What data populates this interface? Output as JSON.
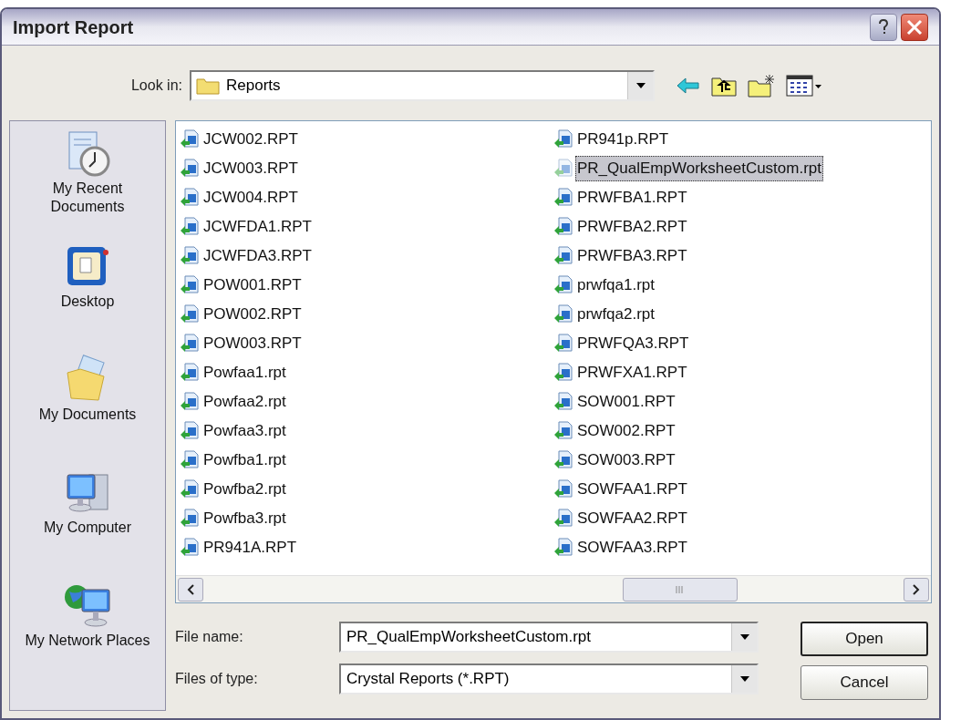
{
  "window": {
    "title": "Import Report"
  },
  "look_in": {
    "label": "Look in:",
    "value": "Reports"
  },
  "places": [
    {
      "kind": "recent",
      "label": "My Recent Documents"
    },
    {
      "kind": "desktop",
      "label": "Desktop"
    },
    {
      "kind": "documents",
      "label": "My Documents"
    },
    {
      "kind": "computer",
      "label": "My Computer"
    },
    {
      "kind": "network",
      "label": "My Network Places"
    }
  ],
  "files": [
    {
      "name": "JCW002.RPT",
      "selected": false
    },
    {
      "name": "JCW003.RPT",
      "selected": false
    },
    {
      "name": "JCW004.RPT",
      "selected": false
    },
    {
      "name": "JCWFDA1.RPT",
      "selected": false
    },
    {
      "name": "JCWFDA3.RPT",
      "selected": false
    },
    {
      "name": "POW001.RPT",
      "selected": false
    },
    {
      "name": "POW002.RPT",
      "selected": false
    },
    {
      "name": "POW003.RPT",
      "selected": false
    },
    {
      "name": "Powfaa1.rpt",
      "selected": false
    },
    {
      "name": "Powfaa2.rpt",
      "selected": false
    },
    {
      "name": "Powfaa3.rpt",
      "selected": false
    },
    {
      "name": "Powfba1.rpt",
      "selected": false
    },
    {
      "name": "Powfba2.rpt",
      "selected": false
    },
    {
      "name": "Powfba3.rpt",
      "selected": false
    },
    {
      "name": "PR941A.RPT",
      "selected": false
    },
    {
      "name": "PR941p.RPT",
      "selected": false
    },
    {
      "name": "PR_QualEmpWorksheetCustom.rpt",
      "selected": true
    },
    {
      "name": "PRWFBA1.RPT",
      "selected": false
    },
    {
      "name": "PRWFBA2.RPT",
      "selected": false
    },
    {
      "name": "PRWFBA3.RPT",
      "selected": false
    },
    {
      "name": "prwfqa1.rpt",
      "selected": false
    },
    {
      "name": "prwfqa2.rpt",
      "selected": false
    },
    {
      "name": "PRWFQA3.RPT",
      "selected": false
    },
    {
      "name": "PRWFXA1.RPT",
      "selected": false
    },
    {
      "name": "SOW001.RPT",
      "selected": false
    },
    {
      "name": "SOW002.RPT",
      "selected": false
    },
    {
      "name": "SOW003.RPT",
      "selected": false
    },
    {
      "name": "SOWFAA1.RPT",
      "selected": false
    },
    {
      "name": "SOWFAA2.RPT",
      "selected": false
    },
    {
      "name": "SOWFAA3.RPT",
      "selected": false
    }
  ],
  "file_name": {
    "label": "File name:",
    "value": "PR_QualEmpWorksheetCustom.rpt"
  },
  "file_type": {
    "label": "Files of type:",
    "value": "Crystal Reports (*.RPT)"
  },
  "buttons": [
    "Open",
    "Cancel"
  ]
}
